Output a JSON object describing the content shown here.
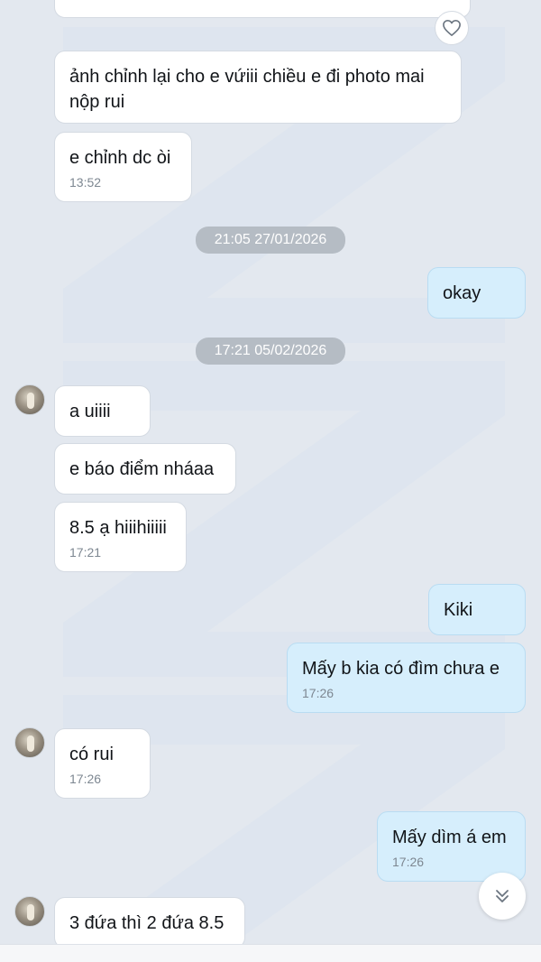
{
  "messages": [
    {
      "text": "",
      "time": ""
    },
    {
      "text": "ảnh chỉnh lại cho e vứiii chiều e đi photo mai nộp rui"
    },
    {
      "text": "e chỉnh dc òi",
      "time": "13:52"
    },
    {
      "divider": "21:05 27/01/2026"
    },
    {
      "text": "okay"
    },
    {
      "divider": "17:21 05/02/2026"
    },
    {
      "text": "a uiiii"
    },
    {
      "text": "e báo điểm nháaa"
    },
    {
      "text": "8.5 ạ hiiihiiiii",
      "time": "17:21"
    },
    {
      "text": "Kiki"
    },
    {
      "text": "Mấy b kia có đìm chưa e",
      "time": "17:26"
    },
    {
      "text": "có rui",
      "time": "17:26"
    },
    {
      "text": "Mấy dìm á em",
      "time": "17:26"
    },
    {
      "text": "3 đứa thì 2 đứa 8.5"
    }
  ],
  "icons": {
    "reaction": "heart-icon",
    "scroll": "chevron-double-down-icon",
    "avatar": "contact-avatar"
  },
  "colors": {
    "background": "#e3e8ef",
    "incoming_bubble": "#ffffff",
    "outgoing_bubble": "#d6eefc",
    "divider_pill": "#b5bcc4",
    "timestamp": "#7d8791"
  }
}
